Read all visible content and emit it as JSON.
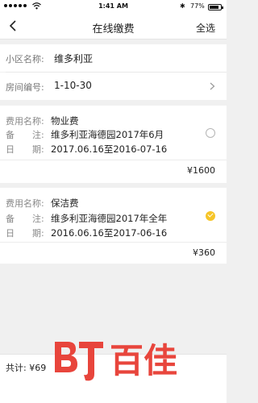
{
  "status_bar": {
    "time": "1:41 AM",
    "battery": "77%",
    "bluetooth_icon": "bluetooth-icon",
    "wifi_icon": "wifi-icon",
    "battery_icon": "battery-icon"
  },
  "nav": {
    "title": "在线缴费",
    "select_all": "全选",
    "back_icon": "chevron-left-icon"
  },
  "info": {
    "community_label": "小区名称:",
    "community_value": "维多利亚",
    "room_label": "房间编号:",
    "room_value": "1-10-30"
  },
  "fees": [
    {
      "name_label": "费用名称:",
      "name_value": "物业费",
      "note_label": "备　　注:",
      "note_value": "维多利亚海德园2017年6月",
      "date_label": "日　　期:",
      "date_value": "2017.06.16至2016-07-16",
      "amount": "¥1600",
      "selected": false
    },
    {
      "name_label": "费用名称:",
      "name_value": "保洁费",
      "note_label": "备　　注:",
      "note_value": "维多利亚海德园2017年全年",
      "date_label": "日　　期:",
      "date_value": "2016.06.16至2017-06-16",
      "amount": "¥360",
      "selected": true
    }
  ],
  "bottom": {
    "total_label": "共计:",
    "total_value": "¥69"
  },
  "watermark": {
    "text": "百佳"
  },
  "colors": {
    "accent_yellow": "#f6c528",
    "watermark_red": "#e8453c"
  }
}
